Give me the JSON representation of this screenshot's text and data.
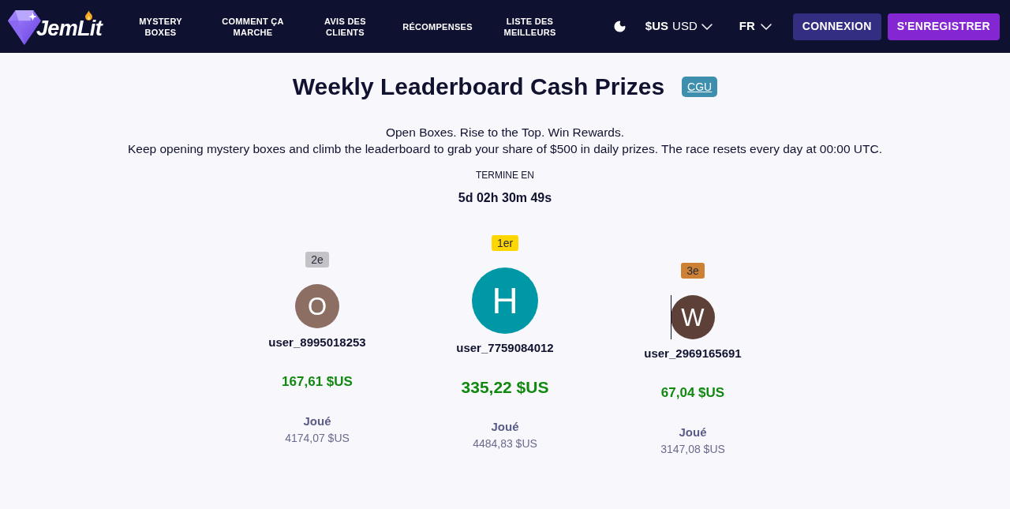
{
  "header": {
    "logo": {
      "text": "JemLit"
    },
    "nav": [
      {
        "label": "MYSTERY BOXES"
      },
      {
        "label": "COMMENT ÇA MARCHE"
      },
      {
        "label": "AVIS DES CLIENTS"
      },
      {
        "label": "RÉCOMPENSES"
      },
      {
        "label": "LISTE DES MEILLEURS"
      }
    ],
    "currency": {
      "symbol": "$US",
      "code": "USD"
    },
    "language": {
      "code": "FR"
    },
    "buttons": [
      {
        "label": "CONNEXION",
        "kind": "secondary"
      },
      {
        "label": "S'ENREGISTRER",
        "kind": "primary"
      }
    ]
  },
  "page": {
    "title": "Weekly Leaderboard Cash Prizes",
    "terms_link": "CGU",
    "tagline": "Open Boxes. Rise to the Top. Win Rewards.",
    "description": "Keep opening mystery boxes and climb the leaderboard to grab your share of $500 in daily prizes. The race resets every day at 00:00 UTC.",
    "countdown": {
      "label": "TERMINE EN",
      "value": "5d 02h 30m 49s"
    }
  },
  "podium": [
    {
      "kind": "second",
      "badge": {
        "label": "2e",
        "color": "#c3c3c7"
      },
      "avatar": {
        "letter": "O",
        "color": "#8d6e63"
      },
      "caret": false,
      "username": "user_8995018253",
      "prize": "167,61 $US",
      "played_label": "Joué",
      "played": "4174,07 $US"
    },
    {
      "kind": "first",
      "badge": {
        "label": "1er",
        "color": "#ffd600"
      },
      "avatar": {
        "letter": "H",
        "color": "#0097a7"
      },
      "caret": false,
      "username": "user_7759084012",
      "prize": "335,22 $US",
      "played_label": "Joué",
      "played": "4484,83 $US"
    },
    {
      "kind": "third",
      "badge": {
        "label": "3e",
        "color": "#cd8134"
      },
      "avatar": {
        "letter": "W",
        "color": "#5d4037"
      },
      "caret": true,
      "username": "user_2969165691",
      "prize": "67,04 $US",
      "played_label": "Joué",
      "played": "3147,08 $US"
    }
  ]
}
